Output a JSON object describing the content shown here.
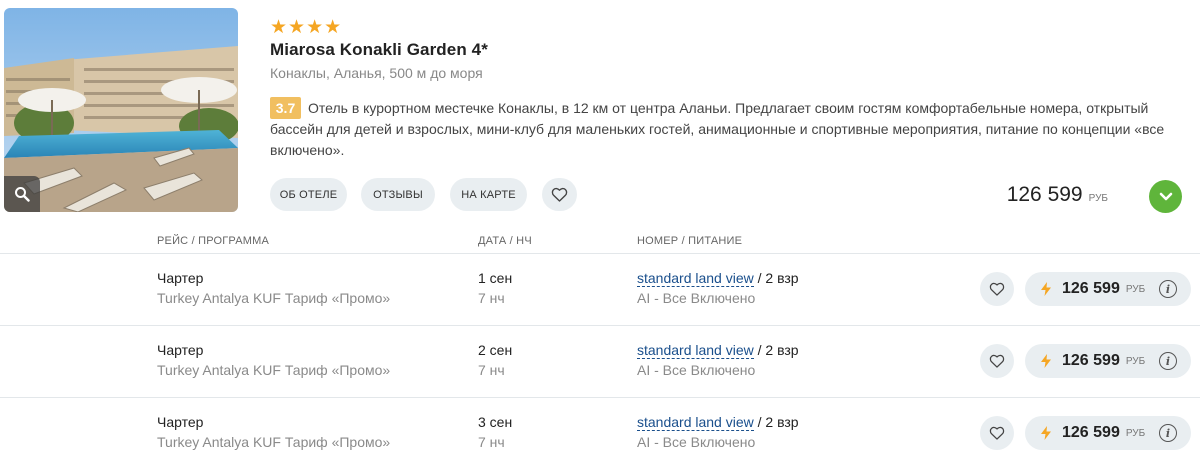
{
  "hotel": {
    "stars": 4,
    "name": "Miarosa Konakli Garden 4*",
    "location": "Конаклы, Аланья, 500 м до моря",
    "rating": "3.7",
    "description": "Отель в курортном местечке Конаклы, в 12 км от центра Аланьи. Предлагает своим гостям комфортабельные номера, открытый бассейн для детей и взрослых, мини-клуб для маленьких гостей, анимационные и спортивные мероприятия, питание по концепции «все включено».",
    "photo_icon": "magnifier-icon",
    "price": "126 599",
    "currency": "РУБ"
  },
  "actions": {
    "about": "ОБ ОТЕЛЕ",
    "reviews": "ОТЗЫВЫ",
    "map": "НА КАРТЕ",
    "favorite_icon": "heart-icon",
    "expand_icon": "chevron-down-icon"
  },
  "table": {
    "headers": {
      "flight": "РЕЙС / ПРОГРАММА",
      "date": "ДАТА / НЧ",
      "room": "НОМЕР / ПИТАНИЕ"
    },
    "rows": [
      {
        "flight_type": "Чартер",
        "program": "Turkey Antalya KUF Тариф «Промо»",
        "date": "1 сен",
        "nights": "7 нч",
        "room": "standard land view",
        "guests": " / 2 взр",
        "meal": "AI - Все Включено",
        "price": "126 599",
        "currency": "РУБ"
      },
      {
        "flight_type": "Чартер",
        "program": "Turkey Antalya KUF Тариф «Промо»",
        "date": "2 сен",
        "nights": "7 нч",
        "room": "standard land view",
        "guests": " / 2 взр",
        "meal": "AI - Все Включено",
        "price": "126 599",
        "currency": "РУБ"
      },
      {
        "flight_type": "Чартер",
        "program": "Turkey Antalya KUF Тариф «Промо»",
        "date": "3 сен",
        "nights": "7 нч",
        "room": "standard land view",
        "guests": " / 2 взр",
        "meal": "AI - Все Включено",
        "price": "126 599",
        "currency": "РУБ"
      }
    ]
  },
  "colors": {
    "star": "#f5a623",
    "rating_badge": "#f1bf60",
    "expand_button": "#5fb53b",
    "room_link": "#1a4f8c",
    "pill_bg": "#e9eef1"
  }
}
